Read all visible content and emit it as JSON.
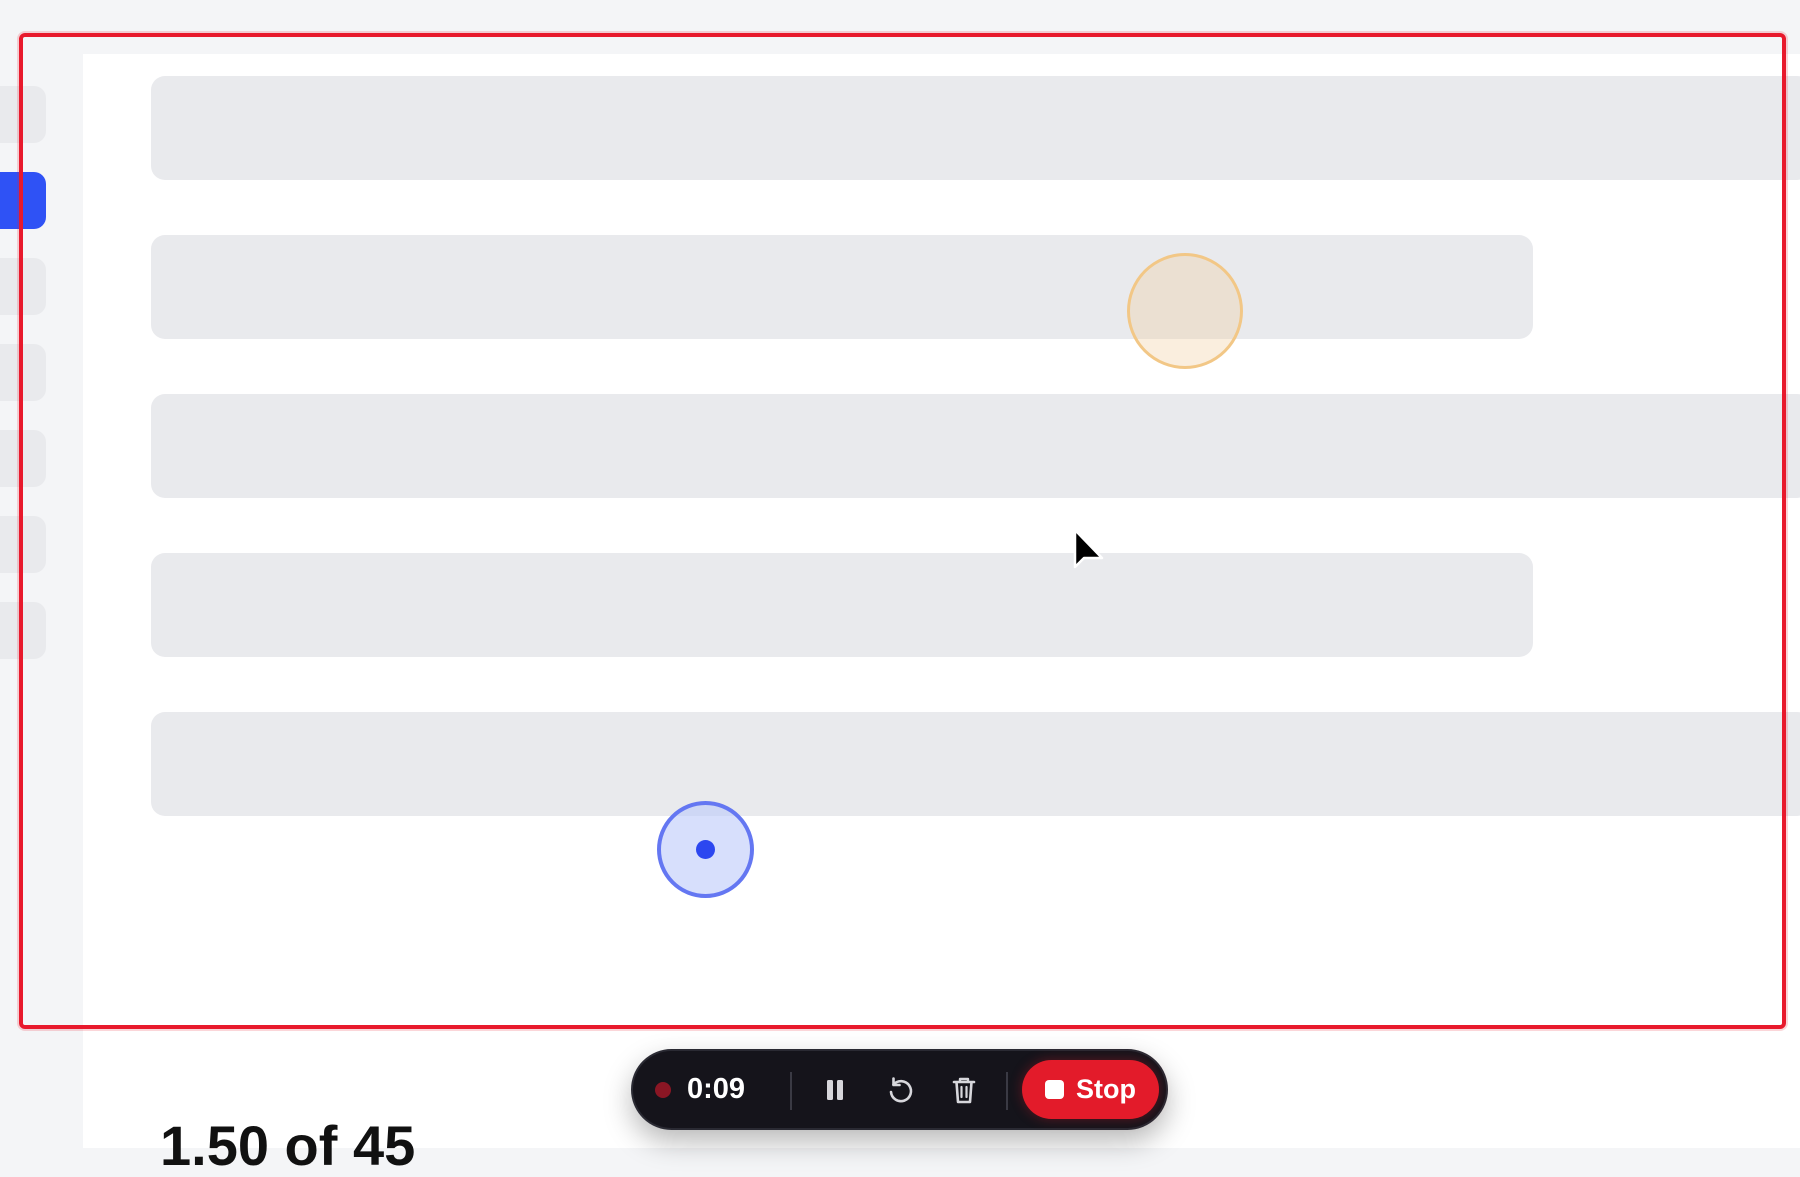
{
  "recorder": {
    "elapsed": "0:09",
    "stop_label": "Stop",
    "pause_icon": "pause-icon",
    "restart_icon": "restart-icon",
    "delete_icon": "trash-icon",
    "accent_color": "#e31b2a"
  },
  "page": {
    "peek_heading": "1.50 of 45"
  },
  "sidebar": {
    "active_color": "#2f52f5",
    "item_count": 7,
    "active_index": 1
  },
  "colors": {
    "frame": "#e8192c",
    "skeleton": "#e9eaed",
    "highlight_orange": "#f2c786",
    "highlight_blue": "#2c47f0"
  }
}
